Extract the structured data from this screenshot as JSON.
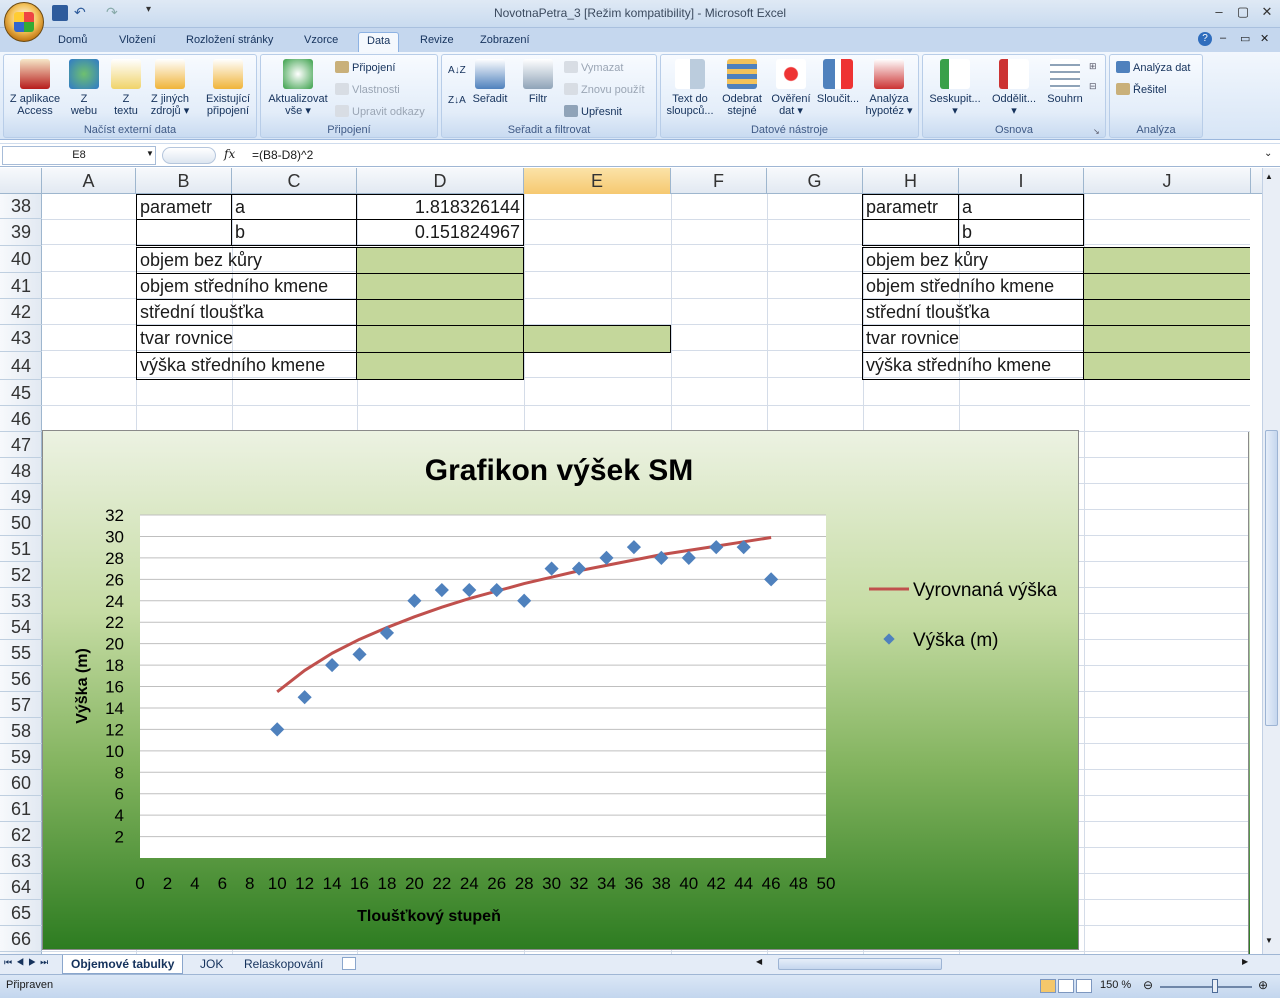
{
  "window": {
    "title": "NovotnaPetra_3  [Režim kompatibility] - Microsoft Excel"
  },
  "ribbon_tabs": [
    "Domů",
    "Vložení",
    "Rozložení stránky",
    "Vzorce",
    "Data",
    "Revize",
    "Zobrazení"
  ],
  "active_tab": "Data",
  "groups": {
    "external": {
      "caption": "Načíst externí data",
      "buttons": [
        {
          "label": "Z aplikace\nAccess",
          "icon": "access-icon"
        },
        {
          "label": "Z\nwebu",
          "icon": "web-icon"
        },
        {
          "label": "Z\ntextu",
          "icon": "text-icon"
        },
        {
          "label": "Z jiných\nzdrojů ▾",
          "icon": "sources-icon"
        },
        {
          "label": "Existující\npřipojení",
          "icon": "connections-icon"
        }
      ]
    },
    "connections": {
      "caption": "Připojení",
      "refresh": "Aktualizovat\nvše ▾",
      "connect": "Připojení",
      "properties": "Vlastnosti",
      "edit_links": "Upravit odkazy"
    },
    "sort": {
      "caption": "Seřadit a filtrovat",
      "sort": "Seřadit",
      "filter": "Filtr",
      "clear": "Vymazat",
      "reapply": "Znovu použít",
      "advanced": "Upřesnit"
    },
    "tools": {
      "caption": "Datové nástroje",
      "buttons": [
        "Text do\nsloupců...",
        "Odebrat\nstejné",
        "Ověření\ndat ▾",
        "Sloučit...",
        "Analýza\nhypotéz ▾"
      ]
    },
    "outline": {
      "caption": "Osnova",
      "buttons": [
        "Seskupit...\n▾",
        "Oddělit...\n▾",
        "Souhrn"
      ]
    },
    "analysis": {
      "caption": "Analýza",
      "data_analysis": "Analýza dat",
      "solver": "Řešitel"
    }
  },
  "formula_bar": {
    "name_box": "E8",
    "fx": "fx",
    "formula": "=(B8-D8)^2"
  },
  "columns": [
    "A",
    "B",
    "C",
    "D",
    "E",
    "F",
    "G",
    "H",
    "I",
    "J"
  ],
  "selected_column": "E",
  "rows": [
    "38",
    "39",
    "40",
    "41",
    "42",
    "43",
    "44",
    "45",
    "46",
    "47",
    "48",
    "49",
    "50",
    "51",
    "52",
    "53",
    "54",
    "55",
    "56",
    "57",
    "58",
    "59",
    "60",
    "61",
    "62",
    "63",
    "64",
    "65",
    "66"
  ],
  "cells": {
    "b38": "parametr",
    "c38": "a",
    "d38": "1.818326144",
    "c39": "b",
    "d39": "0.151824967",
    "b40": "objem bez kůry",
    "b41": "objem středního kmene",
    "b42": "střední tloušťka",
    "b43": "tvar rovnice",
    "b44": "výška středního kmene",
    "h38": "parametr",
    "i38": "a",
    "i39": "b",
    "h40": "objem bez kůry",
    "h41": "objem středního kmene",
    "h42": "střední tloušťka",
    "h43": "tvar rovnice",
    "h44": "výška středního kmene"
  },
  "colors": {
    "cell_fill": "#c4d79b",
    "series_line": "#c0504d",
    "series_points": "#4f81bd"
  },
  "chart_data": {
    "type": "scatter",
    "title": "Grafikon výšek SM",
    "xlabel": "Tloušťkový stupeň",
    "ylabel": "Výška (m)",
    "xlim": [
      0,
      50
    ],
    "ylim": [
      0,
      32
    ],
    "x_ticks": [
      0,
      2,
      4,
      6,
      8,
      10,
      12,
      14,
      16,
      18,
      20,
      22,
      24,
      26,
      28,
      30,
      32,
      34,
      36,
      38,
      40,
      42,
      44,
      46,
      48,
      50
    ],
    "y_ticks": [
      2,
      4,
      6,
      8,
      10,
      12,
      14,
      16,
      18,
      20,
      22,
      24,
      26,
      28,
      30,
      32
    ],
    "grid": "horizontal",
    "legend_position": "right",
    "series": [
      {
        "name": "Vyrovnaná výška",
        "kind": "line",
        "x": [
          10,
          12,
          14,
          16,
          18,
          20,
          22,
          24,
          26,
          28,
          30,
          32,
          34,
          36,
          38,
          40,
          42,
          44,
          46
        ],
        "y": [
          15.5,
          17.5,
          19.1,
          20.4,
          21.5,
          22.5,
          23.4,
          24.2,
          24.9,
          25.6,
          26.2,
          26.8,
          27.3,
          27.8,
          28.3,
          28.7,
          29.1,
          29.5,
          29.9
        ]
      },
      {
        "name": "Výška (m)",
        "kind": "markers",
        "x": [
          10,
          12,
          14,
          16,
          18,
          20,
          22,
          24,
          26,
          28,
          30,
          32,
          34,
          36,
          38,
          40,
          42,
          44,
          46
        ],
        "y": [
          12,
          15,
          18,
          19,
          21,
          24,
          25,
          25,
          25,
          24,
          27,
          27,
          28,
          29,
          28,
          28,
          29,
          29,
          26
        ]
      }
    ]
  },
  "sheets": [
    "Objemové tabulky",
    "JOK",
    "Relaskopování"
  ],
  "active_sheet": "Objemové tabulky",
  "status": {
    "ready": "Připraven",
    "zoom": "150 %"
  }
}
